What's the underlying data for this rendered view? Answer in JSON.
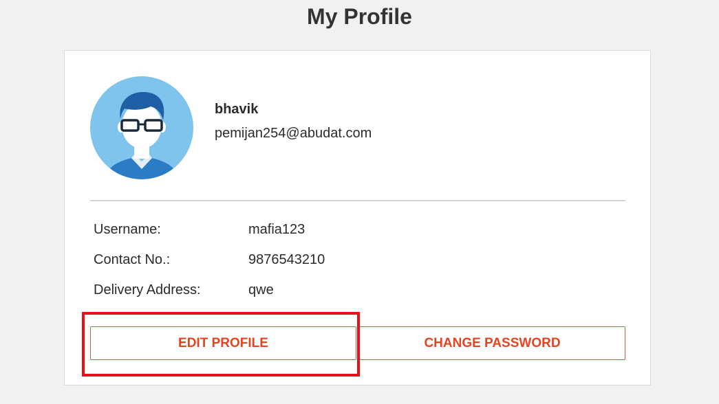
{
  "page": {
    "title": "My Profile"
  },
  "profile": {
    "name": "bhavik",
    "email": "pemijan254@abudat.com",
    "avatar_icon": "user-avatar-icon"
  },
  "details": [
    {
      "label": "Username:",
      "value": "mafia123"
    },
    {
      "label": "Contact No.:",
      "value": "9876543210"
    },
    {
      "label": "Delivery Address:",
      "value": "qwe"
    }
  ],
  "actions": {
    "edit_label": "EDIT PROFILE",
    "password_label": "CHANGE PASSWORD"
  },
  "colors": {
    "accent": "#e8421f",
    "highlight": "#e8101a",
    "avatar_bg": "#7fc4ec",
    "shirt": "#2b7cc4"
  }
}
